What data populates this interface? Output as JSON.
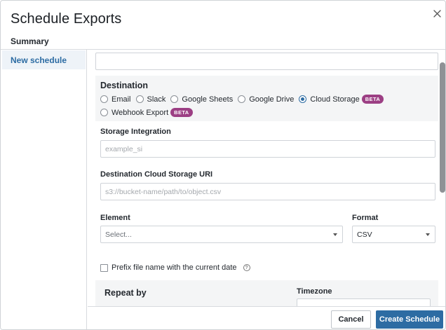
{
  "dialog": {
    "title": "Schedule Exports",
    "subtitle": "Summary"
  },
  "sidebar": {
    "items": [
      {
        "label": "New schedule"
      }
    ]
  },
  "destination": {
    "label": "Destination",
    "options": [
      {
        "label": "Email",
        "checked": false,
        "beta": ""
      },
      {
        "label": "Slack",
        "checked": false,
        "beta": ""
      },
      {
        "label": "Google Sheets",
        "checked": false,
        "beta": ""
      },
      {
        "label": "Google Drive",
        "checked": false,
        "beta": ""
      },
      {
        "label": "Cloud Storage",
        "checked": true,
        "beta": "BETA"
      },
      {
        "label": "Webhook Export",
        "checked": false,
        "beta": "BETA"
      }
    ]
  },
  "storage_integration": {
    "label": "Storage Integration",
    "placeholder": "example_si"
  },
  "destination_uri": {
    "label": "Destination Cloud Storage URI",
    "placeholder": "s3://bucket-name/path/to/object.csv"
  },
  "element": {
    "label": "Element",
    "value": "Select..."
  },
  "format": {
    "label": "Format",
    "value": "CSV"
  },
  "prefix": {
    "label": "Prefix file name with the current date",
    "checked": false,
    "help_icon": "?"
  },
  "repeat": {
    "label": "Repeat by"
  },
  "timezone": {
    "label": "Timezone"
  },
  "footer": {
    "cancel_label": "Cancel",
    "create_label": "Create Schedule"
  },
  "colors": {
    "accent": "#2d6ca3",
    "beta_badge": "#9c3f84",
    "sidebar_active_bg": "#eef3f8"
  }
}
